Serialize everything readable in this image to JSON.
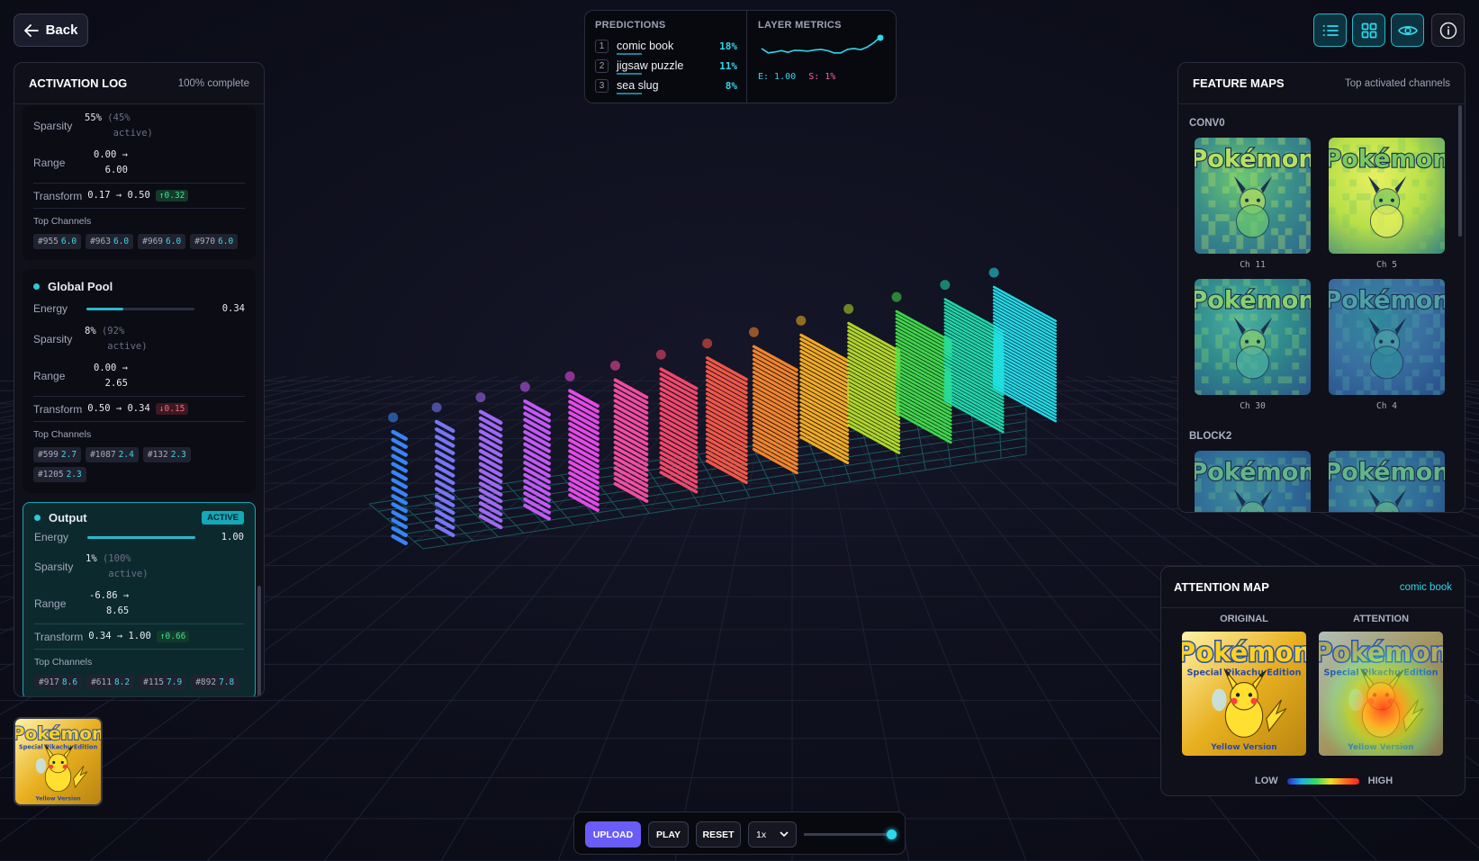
{
  "nav": {
    "back_label": "Back"
  },
  "log": {
    "title": "ACTIVATION LOG",
    "progress": "100% complete",
    "labels": {
      "energy": "Energy",
      "sparsity": "Sparsity",
      "range": "Range",
      "transform": "Transform",
      "top_channels": "Top Channels"
    },
    "partial": {
      "sparsity_value": "55%",
      "sparsity_note": "(45%",
      "sparsity_note2": "active)",
      "range_line1": "0.00 →",
      "range_line2": "6.00",
      "transform": "0.17 → 0.50",
      "delta": "↑0.32",
      "channels": [
        {
          "id": "#955",
          "v": "6.0"
        },
        {
          "id": "#963",
          "v": "6.0"
        },
        {
          "id": "#969",
          "v": "6.0"
        },
        {
          "id": "#970",
          "v": "6.0"
        }
      ]
    },
    "global_pool": {
      "name": "Global Pool",
      "energy": 0.34,
      "energy_text": "0.34",
      "sparsity_value": "8%",
      "sparsity_note": "(92%",
      "sparsity_note2": "active)",
      "range_line1": "0.00 →",
      "range_line2": "2.65",
      "transform": "0.50 → 0.34",
      "delta": "↓0.15",
      "channels": [
        {
          "id": "#599",
          "v": "2.7"
        },
        {
          "id": "#1087",
          "v": "2.4"
        },
        {
          "id": "#132",
          "v": "2.3"
        },
        {
          "id": "#1205",
          "v": "2.3"
        }
      ]
    },
    "output": {
      "name": "Output",
      "badge": "ACTIVE",
      "energy": 1.0,
      "energy_text": "1.00",
      "sparsity_value": "1%",
      "sparsity_note": "(100%",
      "sparsity_note2": "active)",
      "range_line1": "-6.86 →",
      "range_line2": "8.65",
      "transform": "0.34 → 1.00",
      "delta": "↑0.66",
      "channels": [
        {
          "id": "#917",
          "v": "8.6"
        },
        {
          "id": "#611",
          "v": "8.2"
        },
        {
          "id": "#115",
          "v": "7.9"
        },
        {
          "id": "#892",
          "v": "7.8"
        }
      ]
    }
  },
  "predictions": {
    "title": "PREDICTIONS",
    "items": [
      {
        "rank": "1",
        "label": "comic book",
        "pct": "18%"
      },
      {
        "rank": "2",
        "label": "jigsaw puzzle",
        "pct": "11%"
      },
      {
        "rank": "3",
        "label": "sea slug",
        "pct": "8%"
      }
    ]
  },
  "metrics": {
    "title": "LAYER METRICS",
    "energy": "E: 1.00",
    "sparsity": "S: 1%",
    "spark": [
      0.4,
      0.55,
      0.52,
      0.47,
      0.53,
      0.46,
      0.47,
      0.49,
      0.45,
      0.43,
      0.47,
      0.55,
      0.55,
      0.43,
      0.4,
      0.44,
      0.35,
      0.2,
      0.0
    ]
  },
  "toolbar": {
    "icons": [
      "list-icon",
      "grid-icon",
      "eye-icon",
      "info-icon"
    ]
  },
  "feature_maps": {
    "title": "FEATURE MAPS",
    "subtitle": "Top activated channels",
    "groups": [
      {
        "name": "CONV0",
        "channels": [
          "Ch 11",
          "Ch 5",
          "Ch 30",
          "Ch 4"
        ]
      },
      {
        "name": "BLOCK2",
        "channels": [
          "",
          ""
        ]
      }
    ]
  },
  "attention": {
    "title": "ATTENTION MAP",
    "class_label": "comic book",
    "original_label": "ORIGINAL",
    "attention_label": "ATTENTION",
    "legend_low": "LOW",
    "legend_high": "HIGH"
  },
  "image_text": {
    "brand": "Pokémon",
    "edition": "Special Pikachu Edition",
    "version": "Yellow Version"
  },
  "controls": {
    "upload": "UPLOAD",
    "play": "PLAY",
    "reset": "RESET",
    "speed": "1x",
    "speed_options": [
      "1x"
    ],
    "progress": 1.0
  },
  "colors": {
    "accent": "#2fd8ea",
    "upload_bg": "#6a5cf6",
    "active_bg": "#0c2a2e",
    "active_border": "#1aa7b5"
  },
  "layers": {
    "count": 14,
    "colors": [
      "#3a8bff",
      "#7d7bff",
      "#a56dff",
      "#cc5cff",
      "#f04cf0",
      "#ff4fa8",
      "#ff4a6e",
      "#ff5a47",
      "#ff8a2a",
      "#ffb320",
      "#b9e028",
      "#42e04a",
      "#20e0b0",
      "#22e4f0"
    ]
  }
}
